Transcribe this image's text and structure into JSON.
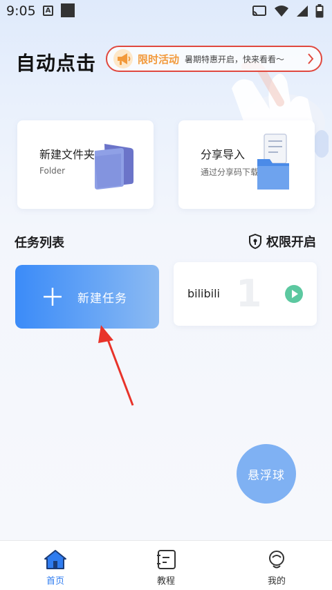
{
  "status_bar": {
    "time": "9:05",
    "notif_letter": "A"
  },
  "header": {
    "title": "自动点击",
    "promo": {
      "title": "限时活动",
      "text": "暑期特惠开启，快来看看～"
    }
  },
  "cards": [
    {
      "title": "新建文件夹",
      "subtitle": "Folder"
    },
    {
      "title": "分享导入",
      "subtitle": "通过分享码下载"
    }
  ],
  "tasks": {
    "section_title": "任务列表",
    "permission_label": "权限开启",
    "new_task_label": "新建任务",
    "items": [
      {
        "name": "bilibili",
        "index": "1"
      }
    ]
  },
  "floating_ball_label": "悬浮球",
  "bottom_nav": [
    {
      "label": "首页",
      "icon": "home-icon",
      "active": true
    },
    {
      "label": "教程",
      "icon": "tutorial-icon",
      "active": false
    },
    {
      "label": "我的",
      "icon": "profile-icon",
      "active": false
    }
  ],
  "colors": {
    "accent": "#2f7cf0",
    "promo_border": "#e0483e",
    "promo_title": "#f2993a",
    "play_green": "#5cc8a0",
    "arrow_red": "#e8332a"
  }
}
